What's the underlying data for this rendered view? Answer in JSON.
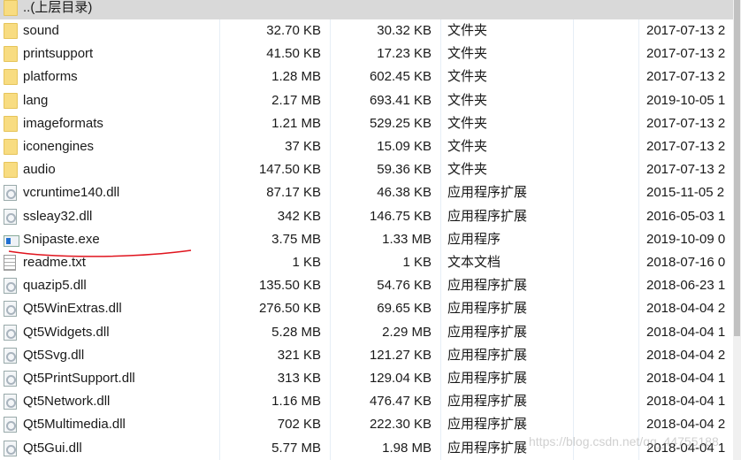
{
  "parent_row": {
    "name": "..(上层目录)"
  },
  "files": [
    {
      "name": "sound",
      "size": "32.70 KB",
      "packed": "30.32 KB",
      "type": "文件夹",
      "date": "2017-07-13 2",
      "icon": "folder"
    },
    {
      "name": "printsupport",
      "size": "41.50 KB",
      "packed": "17.23 KB",
      "type": "文件夹",
      "date": "2017-07-13 2",
      "icon": "folder"
    },
    {
      "name": "platforms",
      "size": "1.28 MB",
      "packed": "602.45 KB",
      "type": "文件夹",
      "date": "2017-07-13 2",
      "icon": "folder"
    },
    {
      "name": "lang",
      "size": "2.17 MB",
      "packed": "693.41 KB",
      "type": "文件夹",
      "date": "2019-10-05 1",
      "icon": "folder"
    },
    {
      "name": "imageformats",
      "size": "1.21 MB",
      "packed": "529.25 KB",
      "type": "文件夹",
      "date": "2017-07-13 2",
      "icon": "folder"
    },
    {
      "name": "iconengines",
      "size": "37 KB",
      "packed": "15.09 KB",
      "type": "文件夹",
      "date": "2017-07-13 2",
      "icon": "folder"
    },
    {
      "name": "audio",
      "size": "147.50 KB",
      "packed": "59.36 KB",
      "type": "文件夹",
      "date": "2017-07-13 2",
      "icon": "folder"
    },
    {
      "name": "vcruntime140.dll",
      "size": "87.17 KB",
      "packed": "46.38 KB",
      "type": "应用程序扩展",
      "date": "2015-11-05 2",
      "icon": "dll"
    },
    {
      "name": "ssleay32.dll",
      "size": "342 KB",
      "packed": "146.75 KB",
      "type": "应用程序扩展",
      "date": "2016-05-03 1",
      "icon": "dll"
    },
    {
      "name": "Snipaste.exe",
      "size": "3.75 MB",
      "packed": "1.33 MB",
      "type": "应用程序",
      "date": "2019-10-09 0",
      "icon": "exe"
    },
    {
      "name": "readme.txt",
      "size": "1 KB",
      "packed": "1 KB",
      "type": "文本文档",
      "date": "2018-07-16 0",
      "icon": "txt"
    },
    {
      "name": "quazip5.dll",
      "size": "135.50 KB",
      "packed": "54.76 KB",
      "type": "应用程序扩展",
      "date": "2018-06-23 1",
      "icon": "dll"
    },
    {
      "name": "Qt5WinExtras.dll",
      "size": "276.50 KB",
      "packed": "69.65 KB",
      "type": "应用程序扩展",
      "date": "2018-04-04 2",
      "icon": "dll"
    },
    {
      "name": "Qt5Widgets.dll",
      "size": "5.28 MB",
      "packed": "2.29 MB",
      "type": "应用程序扩展",
      "date": "2018-04-04 1",
      "icon": "dll"
    },
    {
      "name": "Qt5Svg.dll",
      "size": "321 KB",
      "packed": "121.27 KB",
      "type": "应用程序扩展",
      "date": "2018-04-04 2",
      "icon": "dll"
    },
    {
      "name": "Qt5PrintSupport.dll",
      "size": "313 KB",
      "packed": "129.04 KB",
      "type": "应用程序扩展",
      "date": "2018-04-04 1",
      "icon": "dll"
    },
    {
      "name": "Qt5Network.dll",
      "size": "1.16 MB",
      "packed": "476.47 KB",
      "type": "应用程序扩展",
      "date": "2018-04-04 1",
      "icon": "dll"
    },
    {
      "name": "Qt5Multimedia.dll",
      "size": "702 KB",
      "packed": "222.30 KB",
      "type": "应用程序扩展",
      "date": "2018-04-04 2",
      "icon": "dll"
    },
    {
      "name": "Qt5Gui.dll",
      "size": "5.77 MB",
      "packed": "1.98 MB",
      "type": "应用程序扩展",
      "date": "2018-04-04 1",
      "icon": "dll"
    }
  ],
  "watermark": "https://blog.csdn.net/qq_44755188",
  "colors": {
    "annotation_underline": "#e0141e",
    "header_bg": "#d9d9d9"
  }
}
